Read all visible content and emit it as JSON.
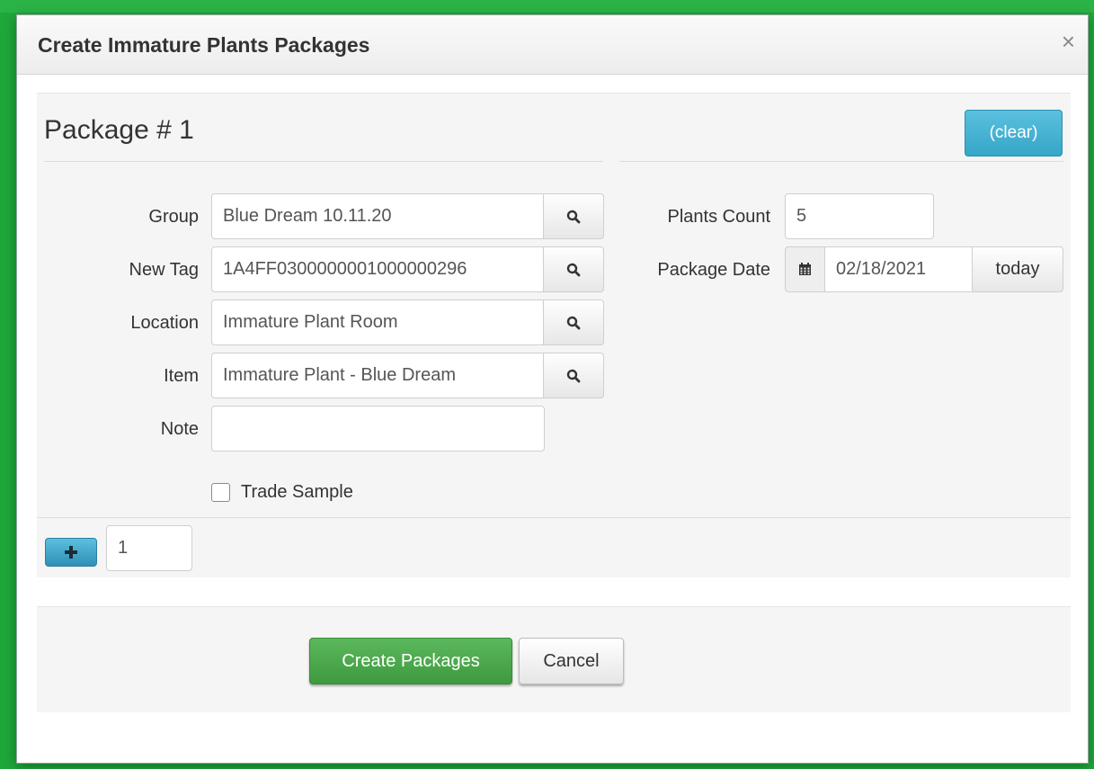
{
  "dialog": {
    "title": "Create Immature Plants Packages",
    "close_symbol": "×"
  },
  "package": {
    "heading": "Package # 1",
    "clear_label": "(clear)",
    "fields": {
      "group": {
        "label": "Group",
        "value": "Blue Dream 10.11.20",
        "lookup_icon": "search-icon"
      },
      "new_tag": {
        "label": "New Tag",
        "value": "1A4FF0300000001000000296",
        "lookup_icon": "search-icon"
      },
      "location": {
        "label": "Location",
        "value": "Immature Plant Room",
        "lookup_icon": "search-icon"
      },
      "item": {
        "label": "Item",
        "value": "Immature Plant - Blue Dream",
        "lookup_icon": "search-icon"
      },
      "note": {
        "label": "Note",
        "value": ""
      },
      "plants_count": {
        "label": "Plants Count",
        "value": "5"
      },
      "package_date": {
        "label": "Package Date",
        "value": "02/18/2021",
        "calendar_icon": "calendar-icon",
        "today_label": "today"
      }
    },
    "trade_sample": {
      "label": "Trade Sample",
      "checked": false
    }
  },
  "add_packages": {
    "add_icon": "plus-icon",
    "count_value": "1"
  },
  "actions": {
    "create_label": "Create Packages",
    "cancel_label": "Cancel"
  },
  "colors": {
    "backdrop_green": "#1fa83a",
    "info_blue": "#5bc0de",
    "success_green": "#5cb85c"
  }
}
